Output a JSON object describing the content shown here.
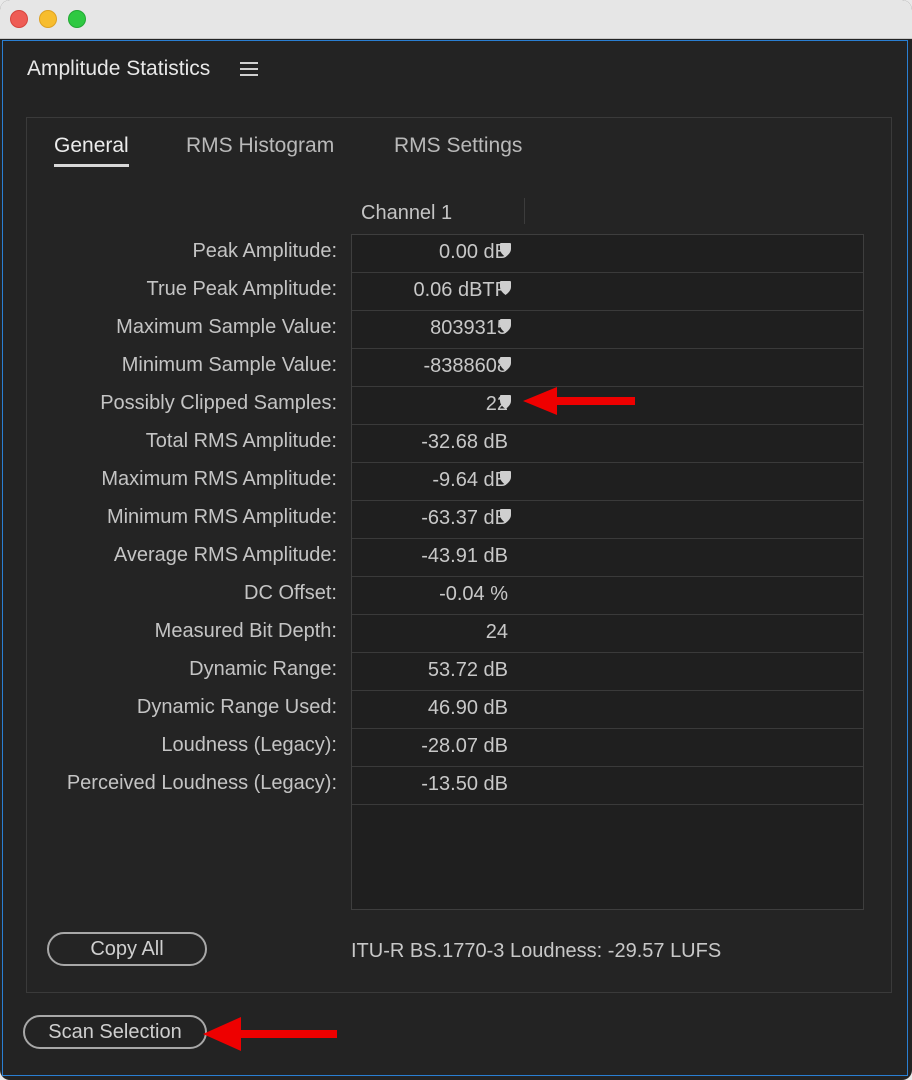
{
  "panel": {
    "title": "Amplitude Statistics"
  },
  "tabs": [
    {
      "label": "General",
      "active": true
    },
    {
      "label": "RMS Histogram",
      "active": false
    },
    {
      "label": "RMS Settings",
      "active": false
    }
  ],
  "table": {
    "column_header": "Channel 1",
    "rows": [
      {
        "label": "Peak Amplitude:",
        "value": "0.00 dB",
        "marker": true
      },
      {
        "label": "True Peak Amplitude:",
        "value": "0.06 dBTP",
        "marker": true
      },
      {
        "label": "Maximum Sample Value:",
        "value": "8039315",
        "marker": true
      },
      {
        "label": "Minimum Sample Value:",
        "value": "-8388608",
        "marker": true
      },
      {
        "label": "Possibly Clipped Samples:",
        "value": "22",
        "marker": true
      },
      {
        "label": "Total RMS Amplitude:",
        "value": "-32.68 dB",
        "marker": false
      },
      {
        "label": "Maximum RMS Amplitude:",
        "value": "-9.64 dB",
        "marker": true
      },
      {
        "label": "Minimum RMS Amplitude:",
        "value": "-63.37 dB",
        "marker": true
      },
      {
        "label": "Average RMS Amplitude:",
        "value": "-43.91 dB",
        "marker": false
      },
      {
        "label": "DC Offset:",
        "value": "-0.04 %",
        "marker": false
      },
      {
        "label": "Measured Bit Depth:",
        "value": "24",
        "marker": false
      },
      {
        "label": "Dynamic Range:",
        "value": "53.72 dB",
        "marker": false
      },
      {
        "label": "Dynamic Range Used:",
        "value": "46.90 dB",
        "marker": false
      },
      {
        "label": "Loudness (Legacy):",
        "value": "-28.07 dB",
        "marker": false
      },
      {
        "label": "Perceived Loudness (Legacy):",
        "value": "-13.50 dB",
        "marker": false
      }
    ]
  },
  "footer": {
    "copy_all_label": "Copy All",
    "loudness_text": "ITU-R BS.1770-3 Loudness:  -29.57 LUFS",
    "scan_selection_label": "Scan Selection"
  },
  "colors": {
    "accent_border": "#2a7fd2",
    "annotation_arrow": "#ee0000"
  }
}
